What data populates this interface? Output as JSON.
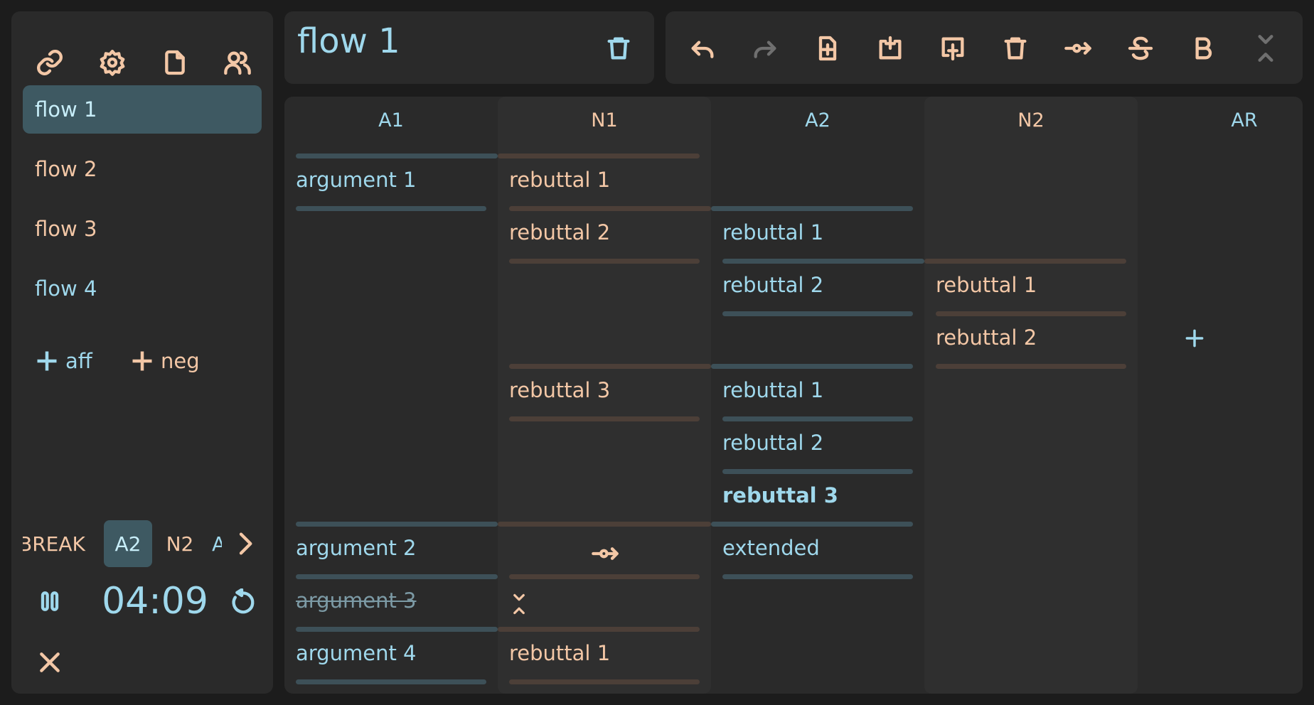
{
  "sidebar": {
    "top_icons": [
      "link-icon",
      "gear-icon",
      "document-icon",
      "users-icon"
    ],
    "flows": [
      {
        "label": "flow 1",
        "active": true
      },
      {
        "label": "flow 2"
      },
      {
        "label": "flow 3"
      },
      {
        "label": "flow 4"
      }
    ],
    "add_aff_label": "aff",
    "add_neg_label": "neg",
    "speeches": [
      "BREAK",
      "A2",
      "N2",
      "AR"
    ],
    "active_speech": "A2",
    "timer": "04:09"
  },
  "title": "flow 1",
  "toolbar": {
    "buttons": [
      "undo-icon",
      "redo-icon",
      "add-box-icon",
      "add-parent-icon",
      "add-child-icon",
      "delete-icon",
      "extend-arrow-icon",
      "strikethrough-icon",
      "bold-icon",
      "collapse-icon"
    ]
  },
  "flow": {
    "columns": [
      "A1",
      "N1",
      "A2",
      "N2",
      "AR"
    ],
    "cells": {
      "a1_1": "argument 1",
      "n1_1": "rebuttal 1",
      "n1_2": "rebuttal 2",
      "a2_1": "rebuttal 1",
      "a2_2": "rebuttal 2",
      "n2_1": "rebuttal 1",
      "n2_2": "rebuttal 2",
      "n1_3": "rebuttal 3",
      "a2_3": "rebuttal 1",
      "a2_4": "rebuttal 2",
      "a2_5": "rebuttal 3",
      "a1_2": "argument 2",
      "a2_6": "extended",
      "a1_3": "argument 3",
      "a1_4": "argument 4",
      "n1_4": "rebuttal 1"
    }
  },
  "colors": {
    "aff": "#9fd8ec",
    "neg": "#f3c7a6",
    "panel": "#2a2a2a",
    "background": "#1c1c1c",
    "active": "#3e5962"
  }
}
